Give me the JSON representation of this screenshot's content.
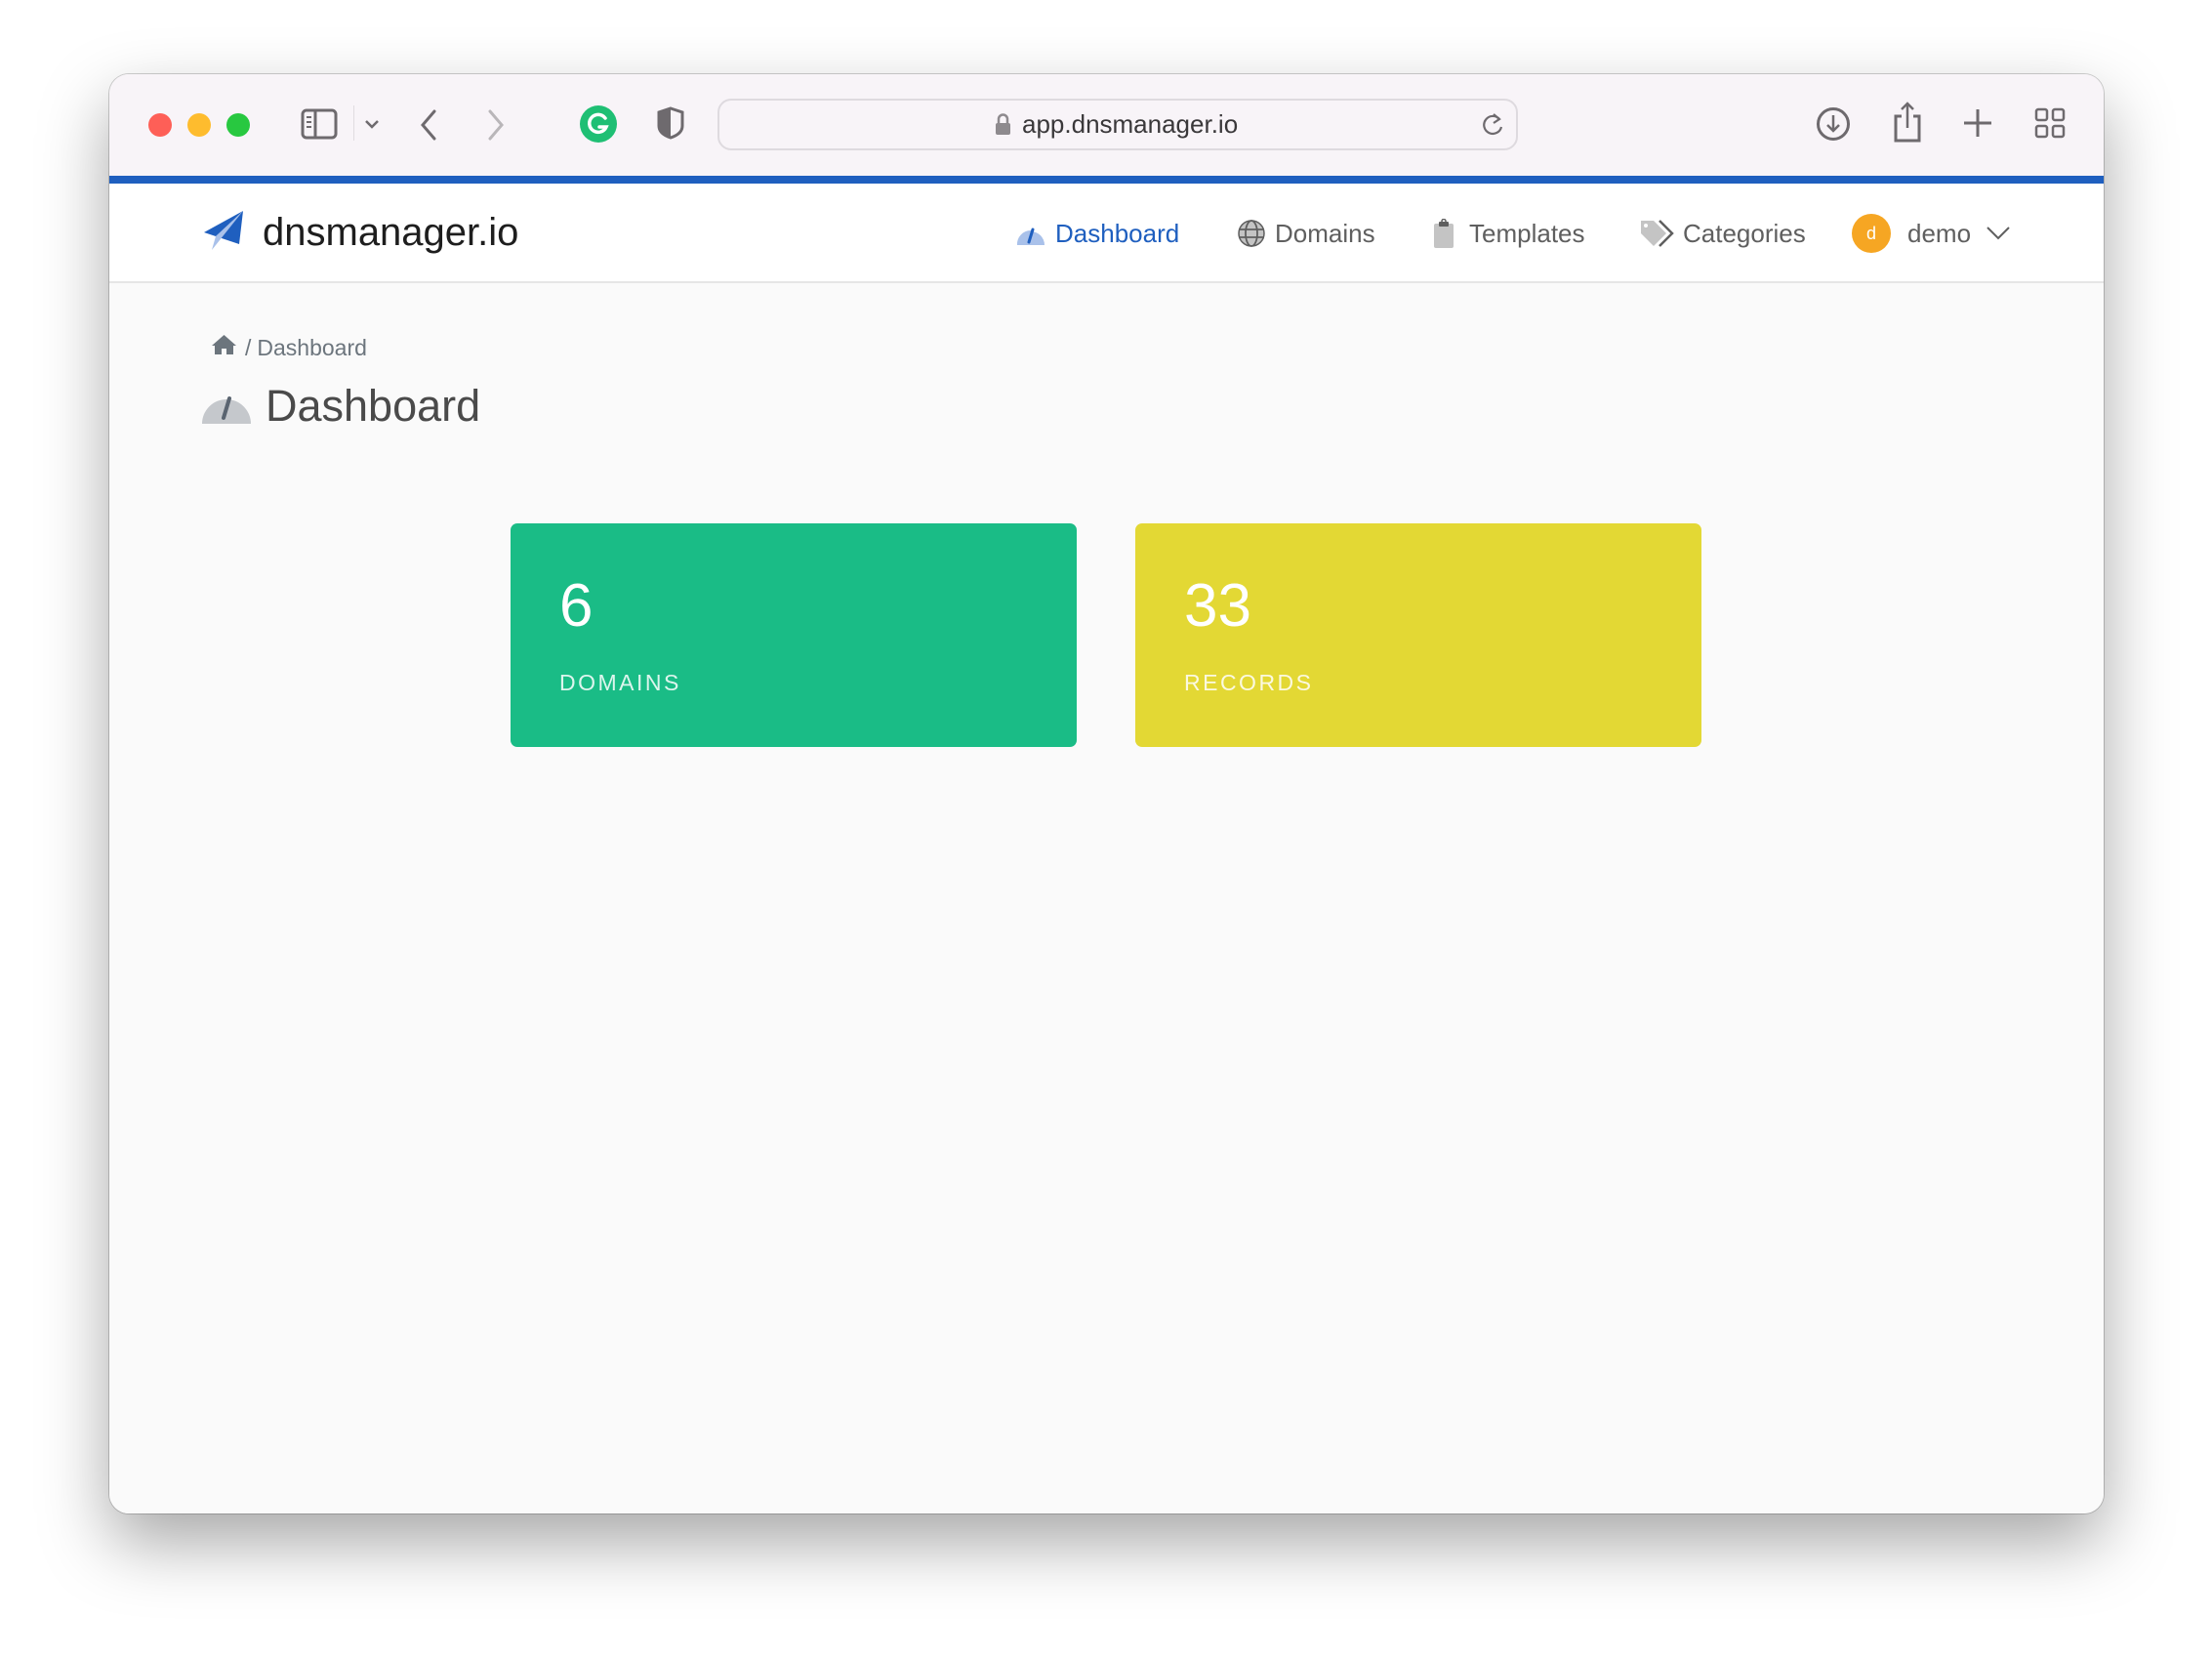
{
  "browser": {
    "url": "app.dnsmanager.io",
    "icons": [
      "sidebar-icon",
      "chevron-down-icon",
      "back-icon",
      "forward-icon",
      "grammarly-icon",
      "shield-icon",
      "lock-icon",
      "reload-icon",
      "download-icon",
      "share-icon",
      "new-tab-icon",
      "tab-overview-icon"
    ]
  },
  "app": {
    "brand": "dnsmanager.io",
    "accent_color": "#1f5fbf"
  },
  "nav": {
    "items": [
      {
        "label": "Dashboard",
        "icon": "dashboard-icon",
        "active": true
      },
      {
        "label": "Domains",
        "icon": "globe-icon",
        "active": false
      },
      {
        "label": "Templates",
        "icon": "clipboard-icon",
        "active": false
      },
      {
        "label": "Categories",
        "icon": "tags-icon",
        "active": false
      }
    ],
    "user": {
      "avatar_letter": "d",
      "name": "demo",
      "avatar_color": "#f6a623"
    }
  },
  "breadcrumb": {
    "separator": "/",
    "current": "Dashboard"
  },
  "page": {
    "title": "Dashboard"
  },
  "stats": [
    {
      "value": "6",
      "label": "DOMAINS",
      "color": "#1abc86"
    },
    {
      "value": "33",
      "label": "RECORDS",
      "color": "#e3d834"
    }
  ]
}
